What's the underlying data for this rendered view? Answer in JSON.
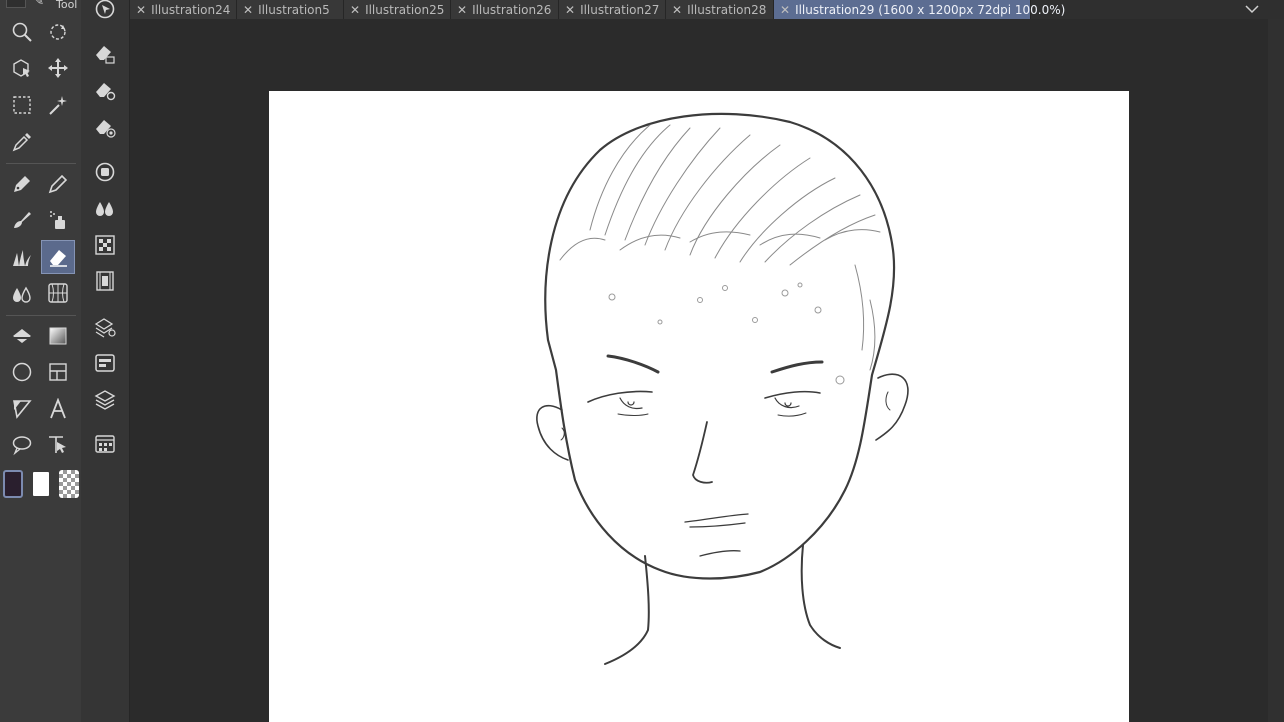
{
  "toolbar": {
    "title": "Tool",
    "colors": {
      "main": "#2a1f2e",
      "sub": "#ffffff",
      "accent": "#5b6a8c"
    },
    "tools": [
      {
        "icon": "zoom-icon"
      },
      {
        "icon": "rotate-view-icon"
      },
      {
        "icon": "object-select-icon"
      },
      {
        "icon": "move-icon"
      },
      {
        "icon": "rectangle-selection-icon"
      },
      {
        "icon": "auto-select-icon"
      },
      {
        "icon": "eyedropper-icon"
      },
      {
        "icon": "pen-icon"
      },
      {
        "icon": "pencil-icon"
      },
      {
        "icon": "brush-icon"
      },
      {
        "icon": "airbrush-icon"
      },
      {
        "icon": "decoration-icon"
      },
      {
        "icon": "eraser-icon",
        "active": true
      },
      {
        "icon": "blend-icon"
      },
      {
        "icon": "perspective-ruler-icon"
      },
      {
        "icon": "fill-icon"
      },
      {
        "icon": "gradient-icon"
      },
      {
        "icon": "figure-icon"
      },
      {
        "icon": "frame-border-icon"
      },
      {
        "icon": "balloon-tail-icon"
      },
      {
        "icon": "text-icon"
      },
      {
        "icon": "balloon-icon"
      },
      {
        "icon": "correct-line-icon"
      }
    ]
  },
  "subtools": [
    {
      "icon": "navigator-icon"
    },
    {
      "icon": "eraser-list-icon"
    },
    {
      "icon": "eraser-settings-icon"
    },
    {
      "icon": "eraser-preset-icon"
    },
    {
      "icon": "brush-size-icon"
    },
    {
      "icon": "color-mix-icon"
    },
    {
      "icon": "material-icon"
    },
    {
      "icon": "timeline-icon"
    },
    {
      "icon": "layer-property-icon"
    },
    {
      "icon": "layer-search-icon"
    },
    {
      "icon": "layer-icon"
    },
    {
      "icon": "item-bank-icon"
    }
  ],
  "tabs": [
    {
      "label": "Illustration24"
    },
    {
      "label": "Illustration5"
    },
    {
      "label": "Illustration25"
    },
    {
      "label": "Illustration26"
    },
    {
      "label": "Illustration27"
    },
    {
      "label": "Illustration28"
    },
    {
      "label": "Illustration29 (1600 x 1200px 72dpi 100.0%)",
      "active": true
    }
  ],
  "tab_close_glyph": "✕",
  "canvas": {
    "background": "#ffffff",
    "subject": "pencil-sketch-face"
  }
}
